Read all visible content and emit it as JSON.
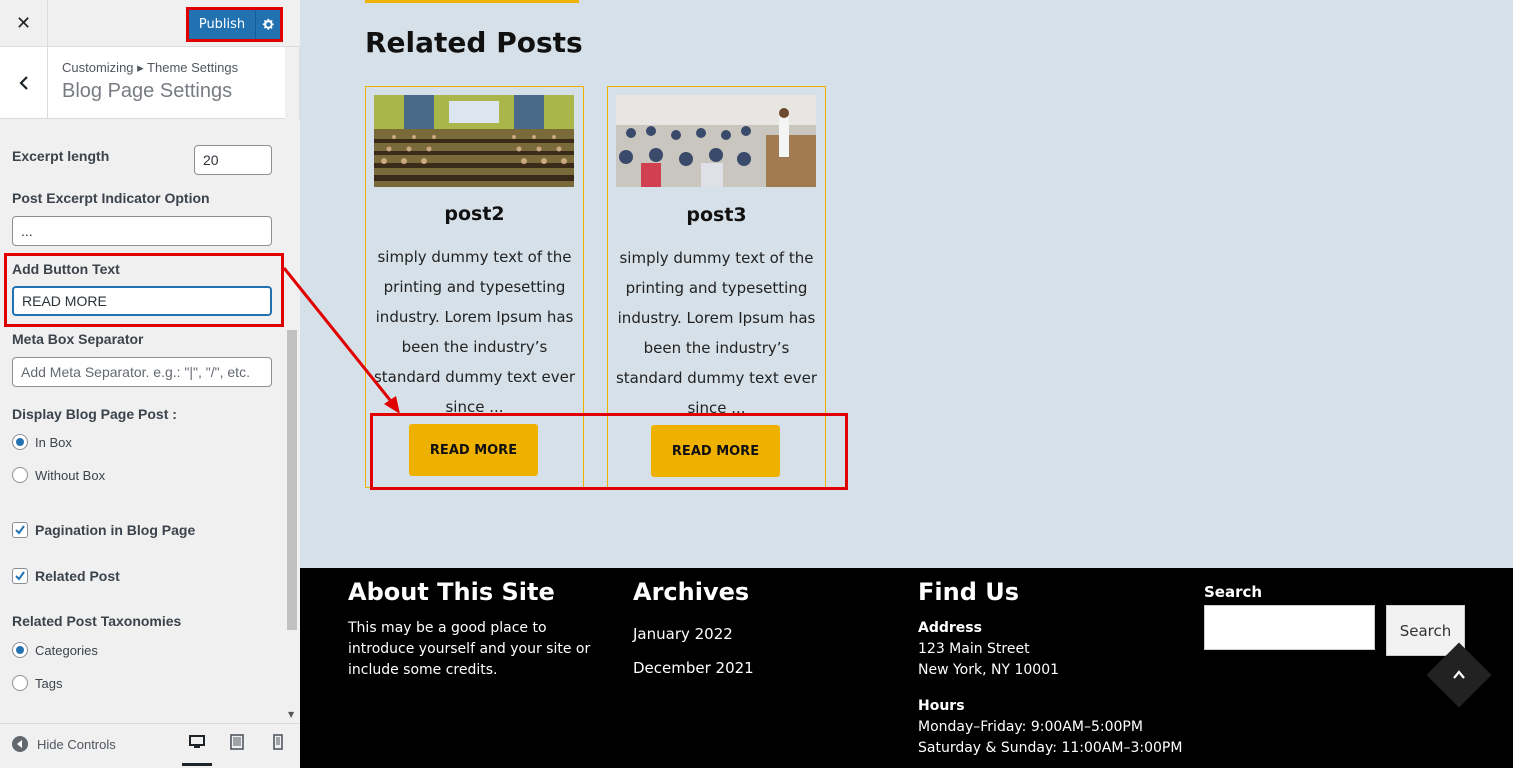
{
  "topbar": {
    "close_glyph": "✕",
    "publish_label": "Publish"
  },
  "section": {
    "breadcrumb": "Customizing ▸ Theme Settings",
    "title": "Blog Page Settings"
  },
  "controls": {
    "excerpt_length_label": "Excerpt length",
    "excerpt_length_value": "20",
    "excerpt_indicator_label": "Post Excerpt Indicator Option",
    "excerpt_indicator_value": "...",
    "button_text_label": "Add Button Text",
    "button_text_value": "READ MORE",
    "meta_separator_label": "Meta Box Separator",
    "meta_separator_placeholder": "Add Meta Separator. e.g.: \"|\", \"/\", etc.",
    "display_label": "Display Blog Page Post :",
    "display_options": [
      {
        "label": "In Box",
        "checked": true
      },
      {
        "label": "Without Box",
        "checked": false
      }
    ],
    "pagination_label": "Pagination in Blog Page",
    "pagination_checked": true,
    "related_post_label": "Related Post",
    "related_post_checked": true,
    "taxonomies_label": "Related Post Taxonomies",
    "taxonomy_options": [
      {
        "label": "Categories",
        "checked": true
      },
      {
        "label": "Tags",
        "checked": false
      }
    ]
  },
  "footer_bar": {
    "hide_controls_label": "Hide Controls",
    "devices": [
      "desktop-icon",
      "tablet-icon",
      "mobile-icon"
    ],
    "active_device": "desktop"
  },
  "preview": {
    "related_title": "Related Posts",
    "posts": [
      {
        "title": "post2",
        "excerpt": "simply dummy text of the printing and typesetting industry. Lorem Ipsum has been the industry’s standard dummy text ever since ...",
        "button": "READ MORE"
      },
      {
        "title": "post3",
        "excerpt": "simply dummy text of the printing and typesetting industry. Lorem Ipsum has been the industry’s standard dummy text ever since ...",
        "button": "READ MORE"
      }
    ],
    "accent_color": "#efb100"
  },
  "site_footer": {
    "about_title": "About This Site",
    "about_text": "This may be a good place to introduce yourself and your site or include some credits.",
    "archives_title": "Archives",
    "archives": [
      "January 2022",
      "December 2021"
    ],
    "find_title": "Find Us",
    "address_label": "Address",
    "address_line1": "123 Main Street",
    "address_line2": "New York, NY 10001",
    "hours_label": "Hours",
    "hours_line1": "Monday–Friday: 9:00AM–5:00PM",
    "hours_line2": "Saturday & Sunday: 11:00AM–3:00PM",
    "search_label": "Search",
    "search_button": "Search"
  }
}
